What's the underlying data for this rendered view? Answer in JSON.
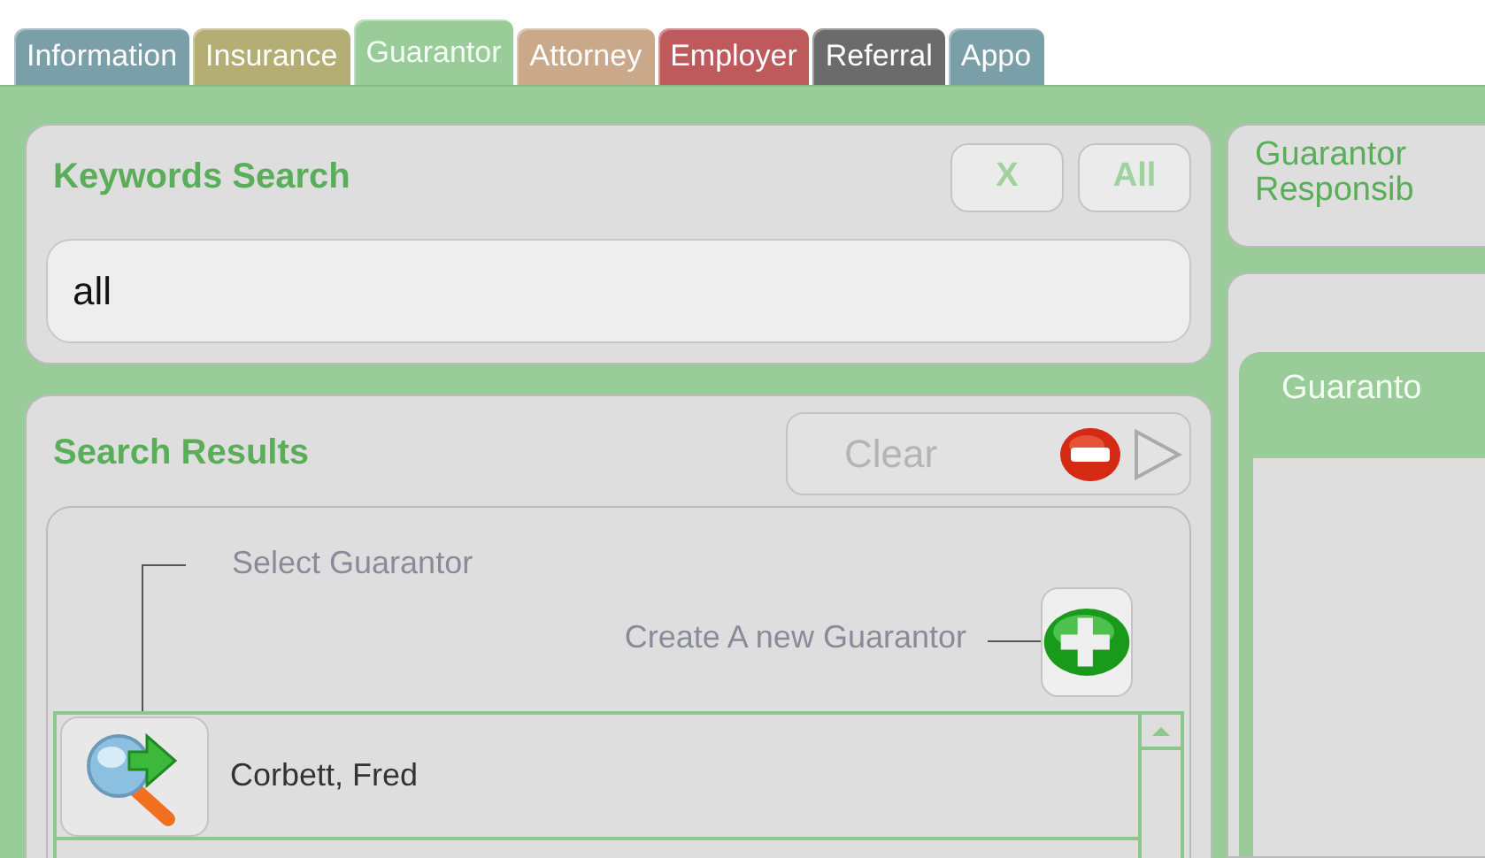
{
  "tabs": [
    {
      "label": "Information",
      "selected": false,
      "color": "#7b9fa9"
    },
    {
      "label": "Insurance",
      "selected": false,
      "color": "#b4ad74"
    },
    {
      "label": "Guarantor",
      "selected": true,
      "color": "#99cc99"
    },
    {
      "label": "Attorney",
      "selected": false,
      "color": "#c9a98a"
    },
    {
      "label": "Employer",
      "selected": false,
      "color": "#bf5a5c"
    },
    {
      "label": "Referral",
      "selected": false,
      "color": "#6b6b6b"
    },
    {
      "label": "Appo",
      "selected": false,
      "color": "#7b9fa9"
    }
  ],
  "keywords_search": {
    "title": "Keywords Search",
    "buttons": [
      "X",
      "All"
    ],
    "value": "all"
  },
  "search_results": {
    "title": "Search Results",
    "clear_button": {
      "label": "Clear",
      "disabled": true
    },
    "select_hint": "Select Guarantor",
    "create_hint": "Create A new Guarantor",
    "rows": [
      {
        "name": "Corbett, Fred"
      }
    ]
  },
  "guarantor_info": {
    "title": "Guarantor Responsib"
  },
  "guarantor_panel": {
    "title": "Guaranto"
  }
}
